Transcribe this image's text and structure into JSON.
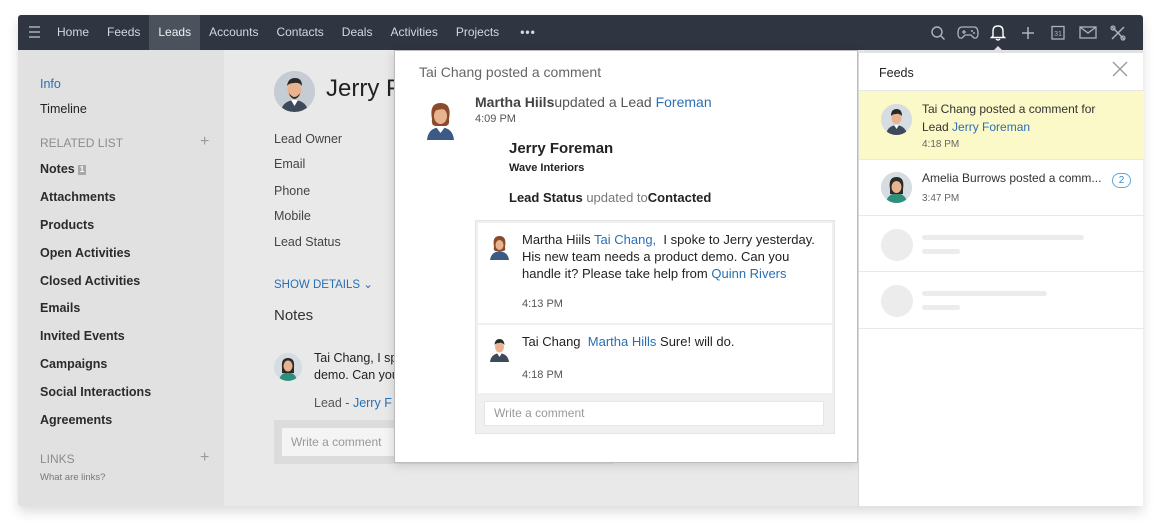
{
  "topbar": {
    "menu_icon": "hamburger-icon",
    "nav": [
      "Home",
      "Feeds",
      "Leads",
      "Accounts",
      "Contacts",
      "Deals",
      "Activities",
      "Projects"
    ],
    "active_nav": "Leads",
    "more": "•••",
    "icons": [
      "search-icon",
      "gamepad-icon",
      "bell-icon",
      "plus-icon",
      "calendar-icon",
      "mail-icon",
      "tools-icon"
    ],
    "active_icon": "bell-icon"
  },
  "sidebar": {
    "info": "Info",
    "timeline": "Timeline",
    "related_header": "RELATED LIST",
    "related": [
      "Notes",
      "Attachments",
      "Products",
      "Open Activities",
      "Closed Activities",
      "Emails",
      "Invited Events",
      "Campaigns",
      "Social Interactions",
      "Agreements"
    ],
    "notes_badge": "1",
    "links_header": "LINKS",
    "links_hint": "What are links?",
    "add_glyph": "+"
  },
  "record": {
    "title": "Jerry F",
    "fields": [
      "Lead Owner",
      "Email",
      "Phone",
      "Mobile",
      "Lead Status"
    ],
    "show_details": "SHOW DETAILS",
    "notes_heading": "Notes",
    "note_text_line1": "Tai Chang, I sp",
    "note_text_line2": "demo. Can you",
    "note_lead_prefix": "Lead -",
    "note_lead_link": "Jerry F",
    "comment_placeholder": "Write a comment"
  },
  "popup": {
    "header": "Tai Chang posted a comment",
    "actor": "Martha Hiils",
    "action": "updated a Lead",
    "action_link": "Foreman",
    "time": "4:09 PM",
    "record_name": "Jerry Foreman",
    "record_company": "Wave Interiors",
    "status_field": "Lead Status",
    "status_verb": "updated to",
    "status_value": "Contacted",
    "messages": [
      {
        "author": "Martha Hiils",
        "mention": "Tai Chang,",
        "text": "I spoke to Jerry yesterday. His new team needs a product demo. Can you handle it? Please take help from",
        "link": "Quinn Rivers",
        "time": "4:13 PM"
      },
      {
        "author": "Tai Chang",
        "mention": "Martha Hills",
        "text": "Sure! will do.",
        "link": "",
        "time": "4:18 PM"
      }
    ],
    "reply_placeholder": "Write a comment"
  },
  "feeds": {
    "title": "Feeds",
    "close_icon": "close-icon",
    "items": [
      {
        "text": "Tai Chang posted a comment for Lead",
        "link": "Jerry Foreman",
        "time": "4:18 PM",
        "highlight": true
      },
      {
        "text": "Amelia Burrows posted a comm...",
        "count": "2",
        "time": "3:47 PM",
        "highlight": false
      }
    ]
  },
  "colors": {
    "topbar": "#2f3541",
    "accent": "#2a6fb4",
    "highlight": "#fbf9c7"
  }
}
